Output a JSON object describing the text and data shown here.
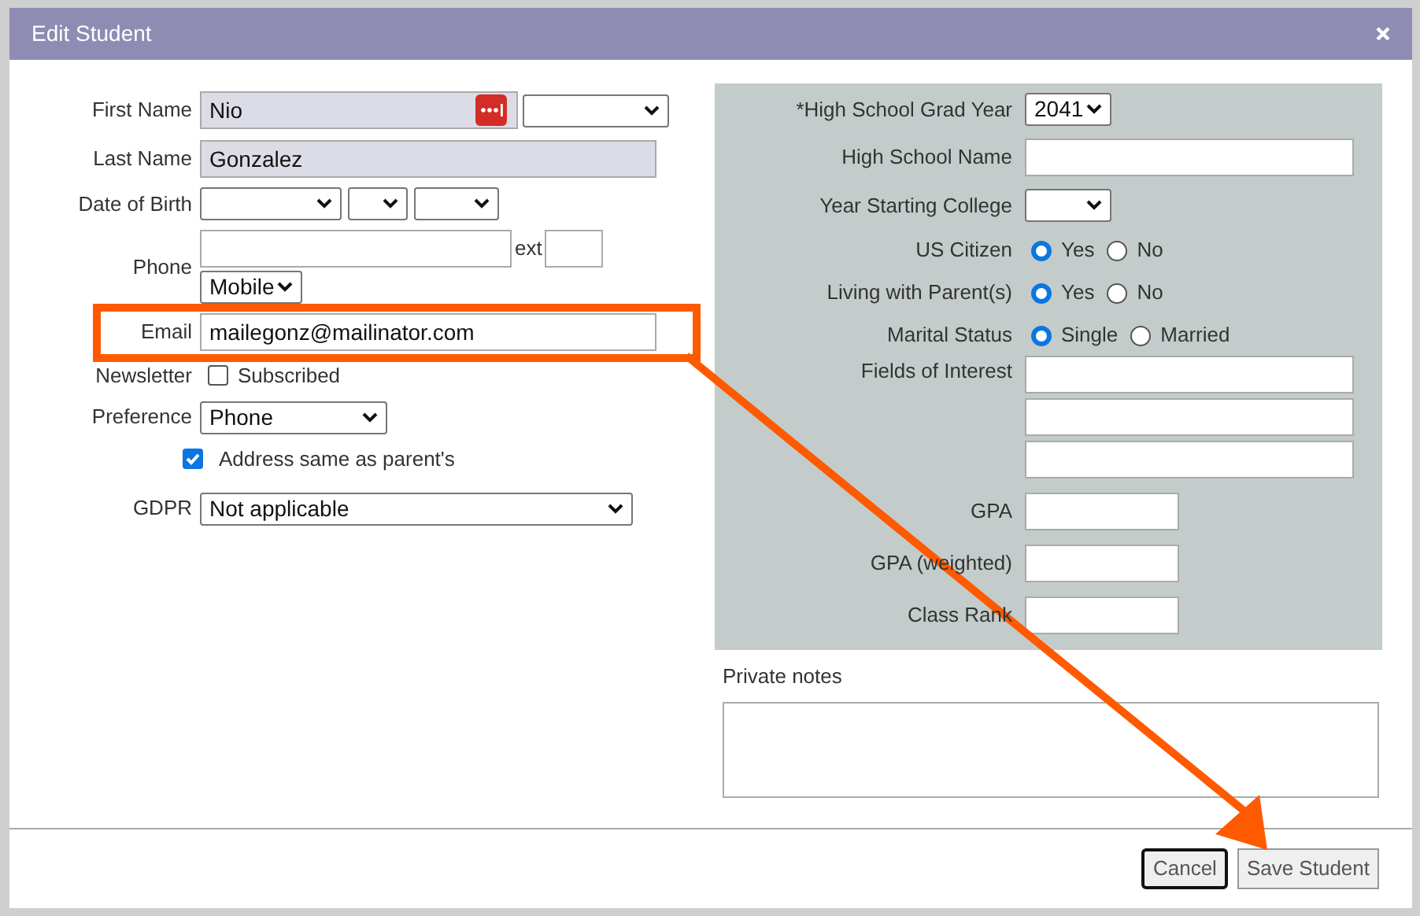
{
  "dialog": {
    "title": "Edit Student"
  },
  "left": {
    "first_name": {
      "label": "First Name",
      "value": "Nio"
    },
    "last_name": {
      "label": "Last Name",
      "value": "Gonzalez"
    },
    "date_of_birth": {
      "label": "Date of Birth"
    },
    "phone": {
      "label": "Phone",
      "ext_label": "ext",
      "type": "Mobile"
    },
    "email": {
      "label": "Email",
      "value": "mailegonz@mailinator.com"
    },
    "newsletter": {
      "label": "Newsletter",
      "option": "Subscribed",
      "checked": false
    },
    "preference": {
      "label": "Preference",
      "value": "Phone"
    },
    "address_same": {
      "label": "Address same as parent's",
      "checked": true
    },
    "gdpr": {
      "label": "GDPR",
      "value": "Not applicable"
    }
  },
  "right": {
    "grad_year": {
      "label": "*High School Grad Year",
      "value": "2041"
    },
    "high_school_name": {
      "label": "High School Name"
    },
    "year_starting_college": {
      "label": "Year Starting College"
    },
    "radio_groups": [
      {
        "label": "US Citizen",
        "options": [
          {
            "label": "Yes",
            "selected": true
          },
          {
            "label": "No",
            "selected": false
          }
        ]
      },
      {
        "label": "Living with Parent(s)",
        "options": [
          {
            "label": "Yes",
            "selected": true
          },
          {
            "label": "No",
            "selected": false
          }
        ]
      },
      {
        "label": "Marital Status",
        "options": [
          {
            "label": "Single",
            "selected": true
          },
          {
            "label": "Married",
            "selected": false
          }
        ]
      }
    ],
    "fields_of_interest": {
      "label": "Fields of Interest"
    },
    "gpa": {
      "label": "GPA"
    },
    "gpa_weighted": {
      "label": "GPA (weighted)"
    },
    "class_rank": {
      "label": "Class Rank"
    }
  },
  "private_notes": {
    "label": "Private notes"
  },
  "buttons": [
    {
      "label": "Cancel",
      "focused": true
    },
    {
      "label": "Save Student",
      "focused": false
    }
  ]
}
